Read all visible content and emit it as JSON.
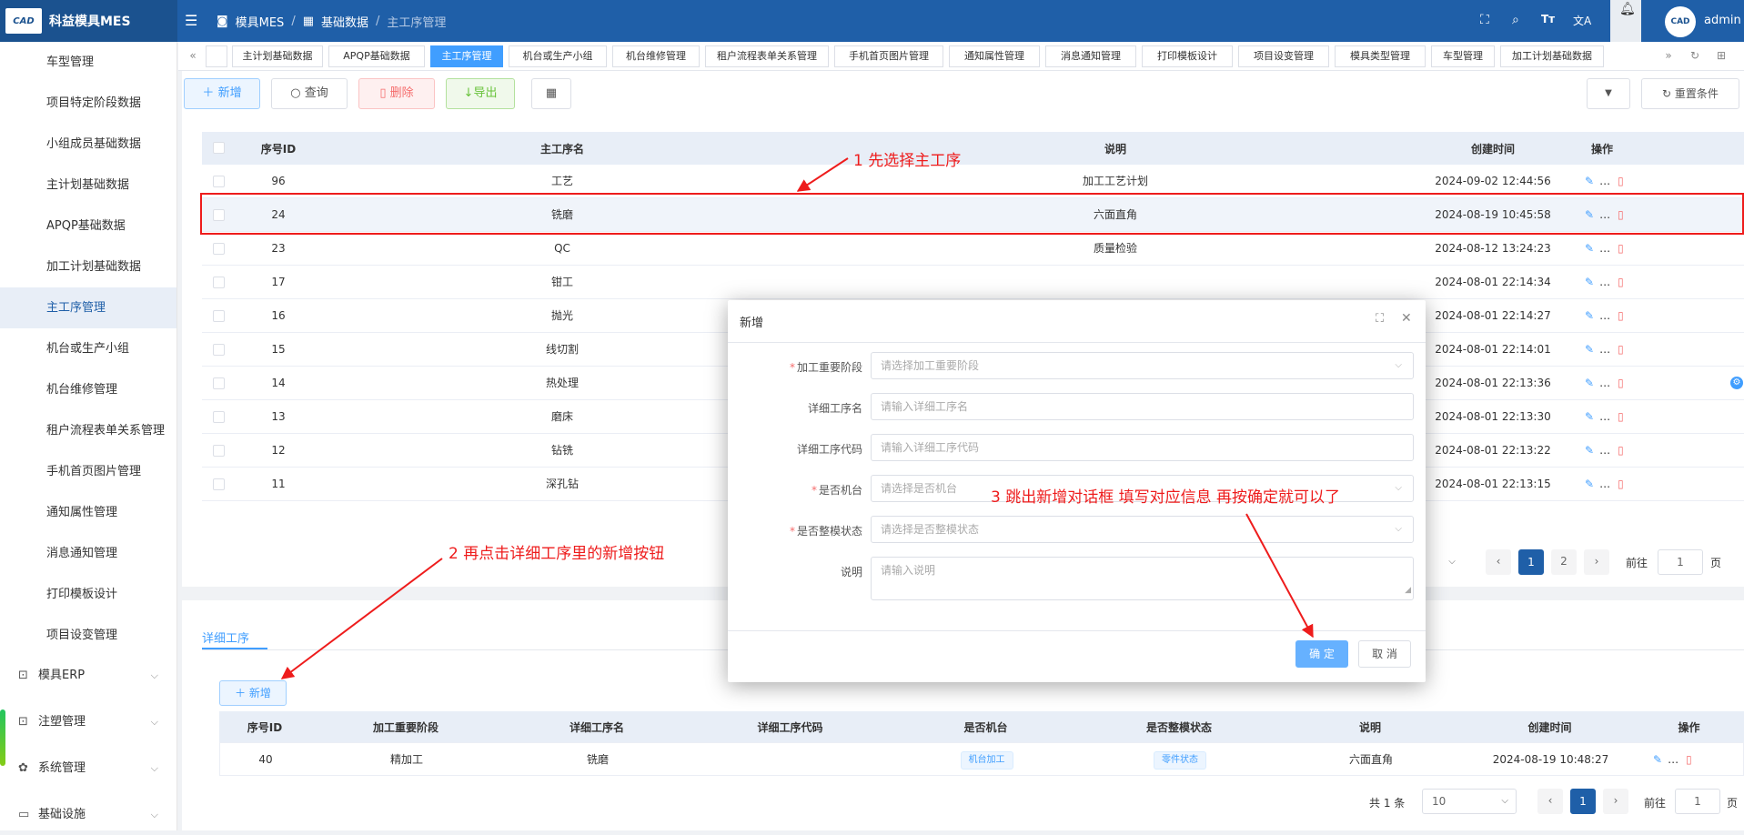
{
  "app": {
    "name": "科益模具MES",
    "logo_text": "CAD",
    "user": "admin"
  },
  "breadcrumb": [
    "模具MES",
    "基础数据",
    "主工序管理"
  ],
  "sidebar": {
    "items": [
      "车型管理",
      "项目特定阶段数据",
      "小组成员基础数据",
      "主计划基础数据",
      "APQP基础数据",
      "加工计划基础数据",
      "主工序管理",
      "机台或生产小组",
      "机台维修管理",
      "租户流程表单关系管理",
      "手机首页图片管理",
      "通知属性管理",
      "消息通知管理",
      "打印模板设计",
      "项目设变管理"
    ],
    "active_index": 6,
    "menus": [
      {
        "label": "模具ERP",
        "icon": "briefcase-icon"
      },
      {
        "label": "注塑管理",
        "icon": "briefcase-icon"
      },
      {
        "label": "系统管理",
        "icon": "gear-icon"
      },
      {
        "label": "基础设施",
        "icon": "monitor-icon"
      }
    ]
  },
  "tabs": [
    "主计划基础数据",
    "APQP基础数据",
    "主工序管理",
    "机台或生产小组",
    "机台维修管理",
    "租户流程表单关系管理",
    "手机首页图片管理",
    "通知属性管理",
    "消息通知管理",
    "打印模板设计",
    "项目设变管理",
    "模具类型管理",
    "车型管理",
    "加工计划基础数据"
  ],
  "active_tab": 2,
  "toolbar": {
    "add": "新增",
    "query": "查询",
    "delete": "删除",
    "export": "导出",
    "reset": "重置条件"
  },
  "main_table": {
    "headers": [
      "序号ID",
      "主工序名",
      "说明",
      "创建时间",
      "操作"
    ],
    "rows": [
      {
        "id": "96",
        "name": "工艺",
        "desc": "加工工艺计划",
        "time": "2024-09-02 12:44:56"
      },
      {
        "id": "24",
        "name": "铣磨",
        "desc": "六面直角",
        "time": "2024-08-19 10:45:58"
      },
      {
        "id": "23",
        "name": "QC",
        "desc": "质量检验",
        "time": "2024-08-12 13:24:23"
      },
      {
        "id": "17",
        "name": "钳工",
        "desc": "",
        "time": "2024-08-01 22:14:34"
      },
      {
        "id": "16",
        "name": "抛光",
        "desc": "",
        "time": "2024-08-01 22:14:27"
      },
      {
        "id": "15",
        "name": "线切割",
        "desc": "",
        "time": "2024-08-01 22:14:01"
      },
      {
        "id": "14",
        "name": "热处理",
        "desc": "",
        "time": "2024-08-01 22:13:36"
      },
      {
        "id": "13",
        "name": "磨床",
        "desc": "",
        "time": "2024-08-01 22:13:30"
      },
      {
        "id": "12",
        "name": "钻铣",
        "desc": "",
        "time": "2024-08-01 22:13:22"
      },
      {
        "id": "11",
        "name": "深孔钻",
        "desc": "",
        "time": "2024-08-01 22:13:15"
      }
    ],
    "pages": [
      "1",
      "2"
    ],
    "goto_label": "前往",
    "goto_value": "1",
    "page_unit": "页"
  },
  "detail": {
    "tab": "详细工序",
    "add": "新增",
    "headers": [
      "序号ID",
      "加工重要阶段",
      "详细工序名",
      "详细工序代码",
      "是否机台",
      "是否整模状态",
      "说明",
      "创建时间",
      "操作"
    ],
    "rows": [
      {
        "id": "40",
        "stage": "精加工",
        "name": "铣磨",
        "code": "",
        "machine": "机台加工",
        "mold": "零件状态",
        "desc": "六面直角",
        "time": "2024-08-19 10:48:27"
      }
    ],
    "total": "共 1 条",
    "page_size": "10",
    "page": "1",
    "goto_label": "前往",
    "goto_value": "1",
    "page_unit": "页"
  },
  "dialog": {
    "title": "新增",
    "fields": [
      {
        "label": "加工重要阶段",
        "required": true,
        "placeholder": "请选择加工重要阶段",
        "type": "select"
      },
      {
        "label": "详细工序名",
        "required": false,
        "placeholder": "请输入详细工序名",
        "type": "input"
      },
      {
        "label": "详细工序代码",
        "required": false,
        "placeholder": "请输入详细工序代码",
        "type": "input"
      },
      {
        "label": "是否机台",
        "required": true,
        "placeholder": "请选择是否机台",
        "type": "select"
      },
      {
        "label": "是否整模状态",
        "required": true,
        "placeholder": "请选择是否整模状态",
        "type": "select"
      },
      {
        "label": "说明",
        "required": false,
        "placeholder": "请输入说明",
        "type": "textarea"
      }
    ],
    "confirm": "确 定",
    "cancel": "取 消"
  },
  "annotations": {
    "step1": "1 先选择主工序",
    "step2": "2 再点击详细工序里的新增按钮",
    "step3": "3 跳出新增对话框 填写对应信息 再按确定就可以了"
  },
  "colors": {
    "header": "#1f5fa8",
    "primary": "#409eff",
    "danger": "#f56c6c",
    "annotation": "#ee1c1c"
  }
}
